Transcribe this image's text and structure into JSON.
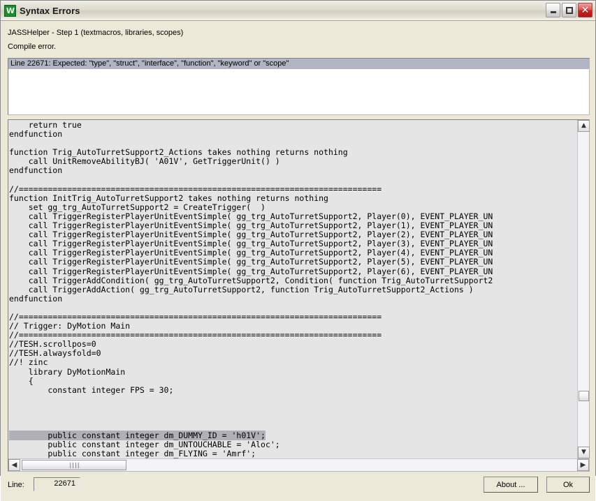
{
  "window": {
    "title": "Syntax Errors",
    "icon": "warcraft-editor-icon",
    "icon_glyph": "W",
    "accent_green": "#1f8a2f",
    "titlebar_buttons": {
      "minimize_label": "Minimize",
      "maximize_label": "Maximize",
      "close_label": "Close"
    }
  },
  "status": {
    "step_line": "JASSHelper - Step 1 (textmacros, libraries, scopes)",
    "compile_line": "Compile error."
  },
  "error_list": {
    "selected_index": 0,
    "highlight_color": "#b0b4c4",
    "rows": [
      "Line 22671: Expected: \"type\", \"struct\", \"interface\", \"function\", \"keyword\" or \"scope\""
    ]
  },
  "code": {
    "selection_color": "#b0b0b8",
    "selected_line_index": 34,
    "lines": [
      "    return true",
      "endfunction",
      "",
      "function Trig_AutoTurretSupport2_Actions takes nothing returns nothing",
      "    call UnitRemoveAbilityBJ( 'A01V', GetTriggerUnit() )",
      "endfunction",
      "",
      "//===========================================================================",
      "function InitTrig_AutoTurretSupport2 takes nothing returns nothing",
      "    set gg_trg_AutoTurretSupport2 = CreateTrigger(  )",
      "    call TriggerRegisterPlayerUnitEventSimple( gg_trg_AutoTurretSupport2, Player(0), EVENT_PLAYER_UN",
      "    call TriggerRegisterPlayerUnitEventSimple( gg_trg_AutoTurretSupport2, Player(1), EVENT_PLAYER_UN",
      "    call TriggerRegisterPlayerUnitEventSimple( gg_trg_AutoTurretSupport2, Player(2), EVENT_PLAYER_UN",
      "    call TriggerRegisterPlayerUnitEventSimple( gg_trg_AutoTurretSupport2, Player(3), EVENT_PLAYER_UN",
      "    call TriggerRegisterPlayerUnitEventSimple( gg_trg_AutoTurretSupport2, Player(4), EVENT_PLAYER_UN",
      "    call TriggerRegisterPlayerUnitEventSimple( gg_trg_AutoTurretSupport2, Player(5), EVENT_PLAYER_UN",
      "    call TriggerRegisterPlayerUnitEventSimple( gg_trg_AutoTurretSupport2, Player(6), EVENT_PLAYER_UN",
      "    call TriggerAddCondition( gg_trg_AutoTurretSupport2, Condition( function Trig_AutoTurretSupport2",
      "    call TriggerAddAction( gg_trg_AutoTurretSupport2, function Trig_AutoTurretSupport2_Actions )",
      "endfunction",
      "",
      "//===========================================================================",
      "// Trigger: DyMotion Main",
      "//===========================================================================",
      "//TESH.scrollpos=0",
      "//TESH.alwaysfold=0",
      "//! zinc",
      "    library DyMotionMain",
      "    {",
      "        constant integer FPS = 30;",
      "",
      "",
      "",
      "",
      "        public constant integer dm_DUMMY_ID = 'h01V';",
      "        public constant integer dm_UNTOUCHABLE = 'Aloc';",
      "        public constant integer dm_FLYING = 'Amrf';"
    ]
  },
  "scrollbars": {
    "vertical": {
      "up_arrow": "▲",
      "down_arrow": "▼",
      "thumb_position_pct": 86
    },
    "horizontal": {
      "left_arrow": "◀",
      "right_arrow": "▶",
      "grip": "||||",
      "thumb_position_pct": 0
    }
  },
  "footer": {
    "line_label": "Line:",
    "line_value": "22671",
    "about_button": "About ...",
    "ok_button": "Ok"
  }
}
